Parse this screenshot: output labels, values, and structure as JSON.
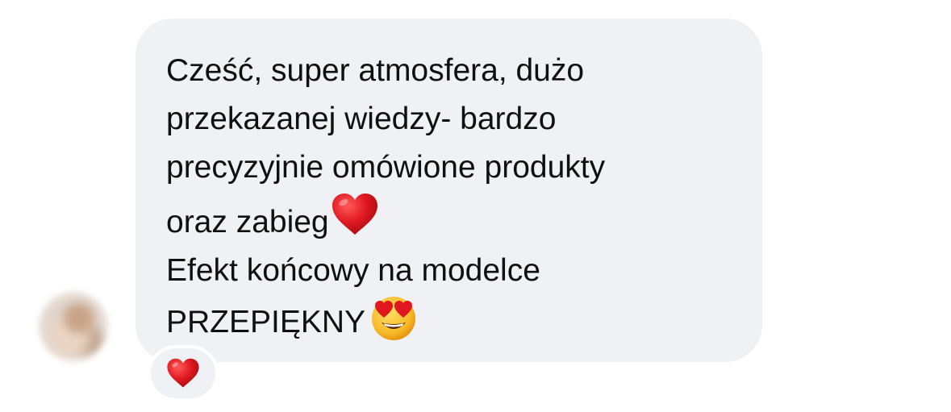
{
  "avatar": {
    "icon": "blurred-profile-photo"
  },
  "message": {
    "lines": [
      "Cześć, super atmosfera, dużo",
      "przekazanej wiedzy- bardzo",
      "precyzyjnie omówione produkty",
      "oraz zabieg",
      "Efekt końcowy na modelce",
      "PRZEPIĘKNY"
    ],
    "line4_emoji": "red-heart-emoji",
    "line6_emoji": "heart-eyes-emoji"
  },
  "reaction": {
    "icon": "red-heart-emoji"
  },
  "colors": {
    "bubble": "#eff1f5",
    "text": "#101010",
    "heart": "#e0171f",
    "emoji_face": "#f7b928"
  }
}
